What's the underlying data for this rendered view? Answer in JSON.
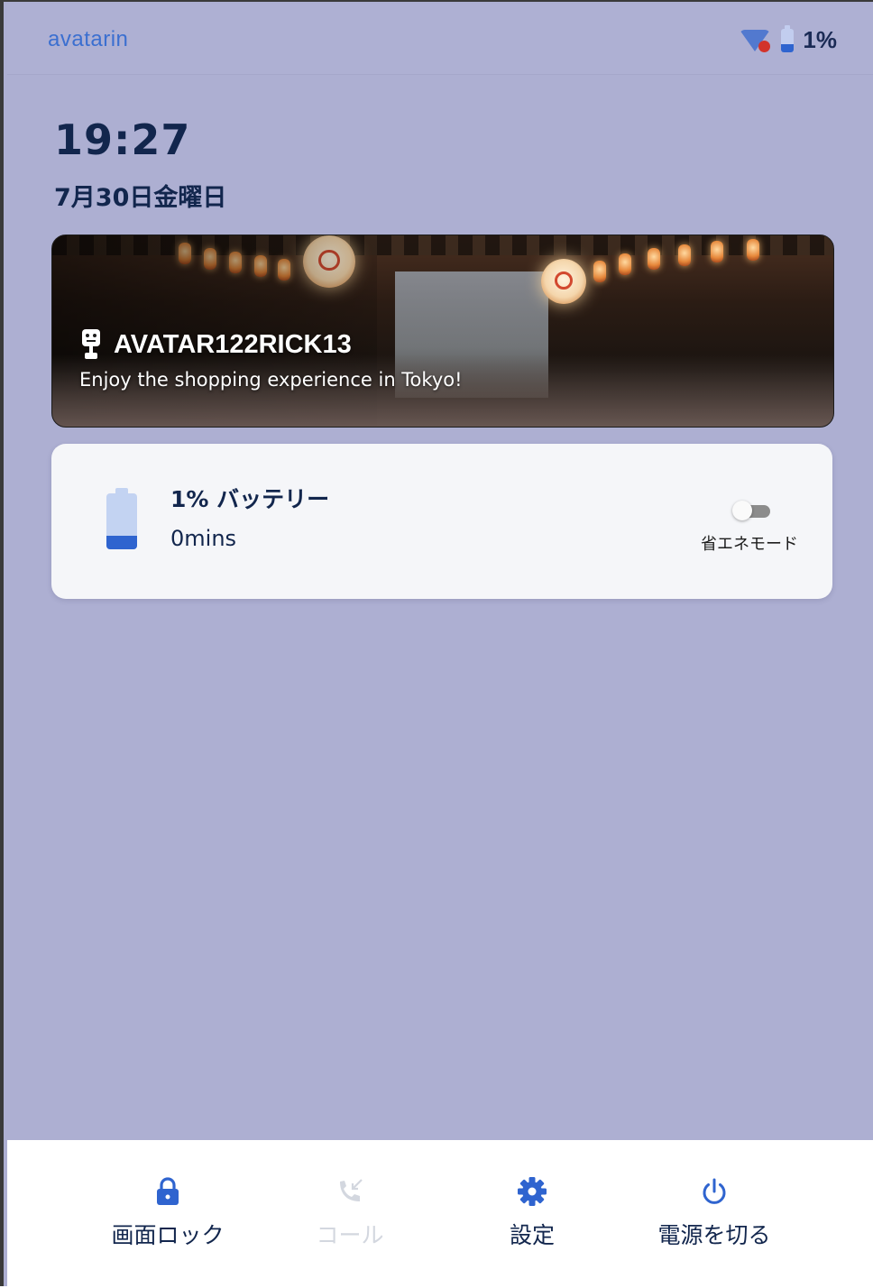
{
  "app": {
    "logo_text": "avatarin",
    "brand_color": "#3b6fd0"
  },
  "status_bar": {
    "wifi_icon": "wifi-icon",
    "wifi_error_color": "#d2332b",
    "battery_icon": "battery-icon",
    "battery_percent_text": "1%",
    "battery_level": 0.01
  },
  "clock": {
    "time": "19:27",
    "date": "7月30日金曜日"
  },
  "banner": {
    "avatar_icon": "robot-icon",
    "avatar_name": "AVATAR122RICK13",
    "description": "Enjoy the shopping experience in Tokyo!"
  },
  "battery_card": {
    "icon": "battery-icon",
    "title": "1% バッテリー",
    "remaining": "0mins",
    "eco_mode_label": "省エネモード",
    "eco_mode_on": false
  },
  "bottom_nav": {
    "items": [
      {
        "label": "画面ロック",
        "icon": "lock-icon",
        "enabled": true
      },
      {
        "label": "コール",
        "icon": "call-icon",
        "enabled": false
      },
      {
        "label": "設定",
        "icon": "gear-icon",
        "enabled": true
      },
      {
        "label": "電源を切る",
        "icon": "power-icon",
        "enabled": true
      }
    ]
  },
  "colors": {
    "background": "#adafd2",
    "text_dark": "#12264d",
    "accent_blue": "#2f64cf",
    "disabled": "#d3d7df"
  }
}
